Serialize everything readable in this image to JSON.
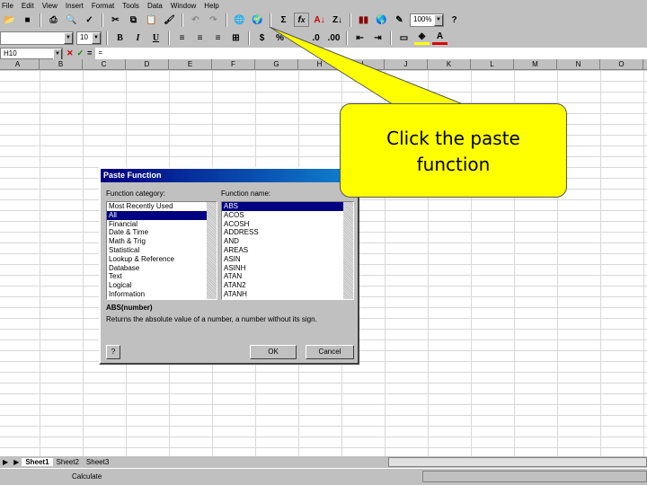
{
  "menu": [
    "File",
    "Edit",
    "View",
    "Insert",
    "Format",
    "Tools",
    "Data",
    "Window",
    "Help"
  ],
  "toolbar": {
    "zoom": "100%",
    "font_size": "10",
    "bold": "B",
    "italic": "I",
    "underline": "U",
    "sum": "Σ",
    "percent": "%",
    "comma": ","
  },
  "formula_bar": {
    "name_box": "H10",
    "equals": "=",
    "content": "="
  },
  "columns": [
    "A",
    "B",
    "C",
    "D",
    "E",
    "F",
    "G",
    "H",
    "I",
    "J",
    "K",
    "L",
    "M",
    "N",
    "O"
  ],
  "dialog": {
    "title": "Paste Function",
    "help": "?",
    "category_label": "Function category:",
    "name_label": "Function name:",
    "categories": [
      "Most Recently Used",
      "All",
      "Financial",
      "Date & Time",
      "Math & Trig",
      "Statistical",
      "Lookup & Reference",
      "Database",
      "Text",
      "Logical",
      "Information"
    ],
    "functions": [
      "ABS",
      "ACOS",
      "ACOSH",
      "ADDRESS",
      "AND",
      "AREAS",
      "ASIN",
      "ASINH",
      "ATAN",
      "ATAN2",
      "ATANH"
    ],
    "syntax": "ABS(number)",
    "description": "Returns the absolute value of a number, a number without its sign.",
    "ok": "OK",
    "cancel": "Cancel"
  },
  "sheets": [
    "Sheet1",
    "Sheet2",
    "Sheet3"
  ],
  "status": "Calculate",
  "callout": {
    "text": "Click the paste function",
    "color": "#ffff00"
  }
}
